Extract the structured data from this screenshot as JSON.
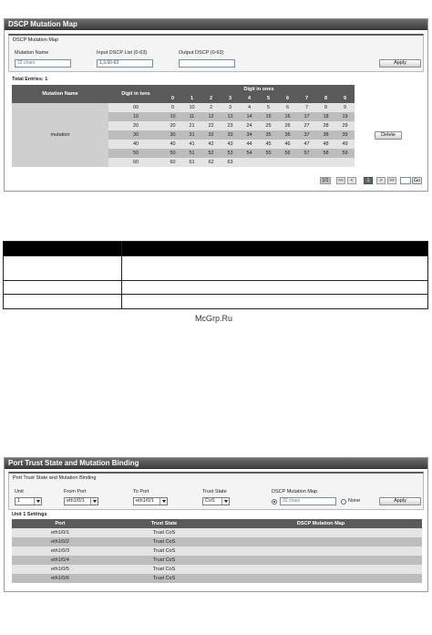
{
  "mutation_window": {
    "title": "DSCP Mutation Map",
    "section_title": "DSCP Mutation Map",
    "form": {
      "mutation_name_label": "Mutation Name",
      "mutation_name_placeholder": "32 chars",
      "input_list_label": "Input DSCP List (0-63)",
      "input_list_value": "1,3,60-63",
      "output_label": "Output DSCP (0-63)",
      "output_value": "",
      "apply_label": "Apply"
    },
    "total_entries": "Total Entries: 1",
    "table": {
      "col_mutation_name": "Mutation Name",
      "col_digit_tens": "Digit in tens",
      "col_digit_ones": "Digit in ones",
      "ones": [
        "0",
        "1",
        "2",
        "3",
        "4",
        "5",
        "6",
        "7",
        "8",
        "9"
      ],
      "mutation_name": "mutation",
      "delete_label": "Delete",
      "rows": [
        {
          "tens": "00",
          "cells": [
            "0",
            "10",
            "2",
            "3",
            "4",
            "5",
            "6",
            "7",
            "8",
            "9"
          ]
        },
        {
          "tens": "10",
          "cells": [
            "10",
            "11",
            "12",
            "13",
            "14",
            "15",
            "16",
            "17",
            "18",
            "19"
          ]
        },
        {
          "tens": "20",
          "cells": [
            "20",
            "21",
            "22",
            "23",
            "24",
            "25",
            "26",
            "27",
            "28",
            "29"
          ]
        },
        {
          "tens": "30",
          "cells": [
            "30",
            "31",
            "32",
            "33",
            "34",
            "35",
            "36",
            "37",
            "38",
            "39"
          ]
        },
        {
          "tens": "40",
          "cells": [
            "40",
            "41",
            "42",
            "43",
            "44",
            "45",
            "46",
            "47",
            "48",
            "49"
          ]
        },
        {
          "tens": "50",
          "cells": [
            "50",
            "51",
            "52",
            "53",
            "54",
            "55",
            "56",
            "57",
            "58",
            "59"
          ]
        },
        {
          "tens": "60",
          "cells": [
            "60",
            "61",
            "62",
            "63",
            "",
            "",
            "",
            "",
            "",
            ""
          ]
        }
      ]
    },
    "pager": {
      "page_info": "1/1",
      "first": "<<",
      "prev": "<",
      "current": "1",
      "next": ">",
      "last": ">>",
      "go_label": "Go"
    }
  },
  "watermark": "McGrp.Ru",
  "binding_window": {
    "title": "Port Trust State and Mutation Binding",
    "section_title": "Port Trust State and Mutation Binding",
    "form": {
      "unit_label": "Unit",
      "unit_value": "1",
      "from_port_label": "From Port",
      "from_port_value": "eth1/0/1",
      "to_port_label": "To Port",
      "to_port_value": "eth1/0/1",
      "trust_state_label": "Trust State",
      "trust_state_value": "CoS",
      "mutation_map_label": "DSCP Mutation Map",
      "mutation_map_placeholder": "32 chars",
      "none_label": "None",
      "apply_label": "Apply"
    },
    "settings_title": "Unit 1 Settings",
    "table": {
      "col_port": "Port",
      "col_trust_state": "Trust State",
      "col_mutation_map": "DSCP Mutation Map",
      "rows": [
        {
          "port": "eth1/0/1",
          "trust": "Trust CoS",
          "map": ""
        },
        {
          "port": "eth1/0/2",
          "trust": "Trust CoS",
          "map": ""
        },
        {
          "port": "eth1/0/3",
          "trust": "Trust CoS",
          "map": ""
        },
        {
          "port": "eth1/0/4",
          "trust": "Trust CoS",
          "map": ""
        },
        {
          "port": "eth1/0/5",
          "trust": "Trust CoS",
          "map": ""
        },
        {
          "port": "eth1/0/6",
          "trust": "Trust CoS",
          "map": ""
        }
      ]
    }
  }
}
